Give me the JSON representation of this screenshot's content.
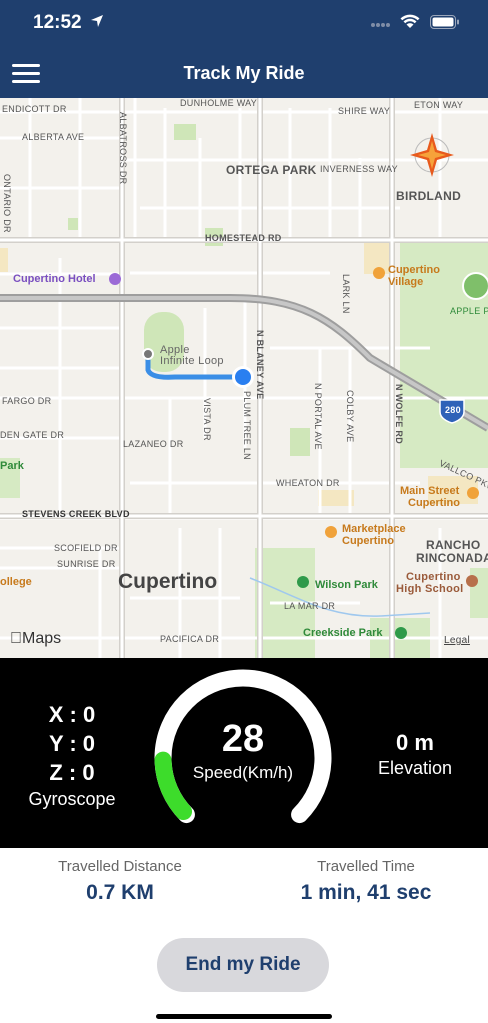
{
  "status_bar": {
    "time": "12:52"
  },
  "nav": {
    "title": "Track My Ride"
  },
  "map": {
    "labels": {
      "endicott": "ENDICOTT DR",
      "albatross": "ALBATROSS DR",
      "dunholme": "DUNHOLME WAY",
      "shire": "SHIRE WAY",
      "eton": "ETON WAY",
      "alberta": "ALBERTA AVE",
      "ortega": "ORTEGA PARK",
      "inverness": "INVERNESS WAY",
      "birdland": "BIRDLAND",
      "ontario": "ONTARIO DR",
      "homestead": "HOMESTEAD RD",
      "cupertino_hotel": "Cupertino Hotel",
      "cupertino_village_1": "Cupertino",
      "cupertino_village_2": "Village",
      "apple_p": "APPLE P",
      "lark": "LARK LN",
      "apple_loop_1": "Apple",
      "apple_loop_2": "Infinite Loop",
      "blaney": "N BLANEY AVE",
      "portal": "N PORTAL AVE",
      "colby": "COLBY AVE",
      "wolfe": "N WOLFE RD",
      "i280": "280",
      "fargo": "FARGO DR",
      "vista": "VISTA DR",
      "plum": "PLUM TREE LN",
      "golden": "DEN GATE DR",
      "lazaneo": "LAZANEO DR",
      "park": "Park",
      "vallco": "VALLCO PKWY",
      "wheaton": "WHEATON DR",
      "main_street_1": "Main Street",
      "main_street_2": "Cupertino",
      "stevens": "STEVENS CREEK BLVD",
      "marketplace_1": "Marketplace",
      "marketplace_2": "Cupertino",
      "rancho_1": "RANCHO",
      "rancho_2": "RINCONADA",
      "scofield": "SCOFIELD DR",
      "sunrise": "SUNRISE DR",
      "cupertino_city": "Cupertino",
      "college": "ollege",
      "wilson": "Wilson Park",
      "cup_high_1": "Cupertino",
      "cup_high_2": "High School",
      "lamar": "LA MAR DR",
      "pacifica": "PACIFICA DR",
      "creekside": "Creekside Park",
      "maps": "Maps",
      "legal": "Legal"
    }
  },
  "dashboard": {
    "gyro": {
      "x": "X : 0",
      "y": "Y : 0",
      "z": "Z : 0",
      "label": "Gyroscope"
    },
    "speed": {
      "value": "28",
      "label": "Speed(Km/h)",
      "gauge_fill_fraction": 0.15
    },
    "elevation": {
      "value": "0 m",
      "label": "Elevation"
    }
  },
  "stats": {
    "distance_label": "Travelled Distance",
    "distance_value": "0.7 KM",
    "time_label": "Travelled Time",
    "time_value": "1 min, 41 sec"
  },
  "actions": {
    "end_ride": "End my Ride"
  },
  "colors": {
    "header": "#1f3f6e",
    "gauge_fill": "#3ddc2b",
    "accent_text": "#1f3f6e",
    "route": "#3a8ee6"
  }
}
